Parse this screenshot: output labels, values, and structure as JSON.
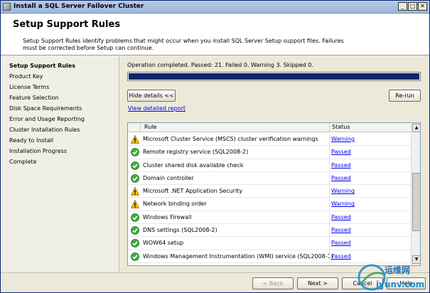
{
  "window": {
    "title": "Install a SQL Server Failover Cluster"
  },
  "header": {
    "title": "Setup Support Rules",
    "description": "Setup Support Rules identify problems that might occur when you install SQL Server Setup support files. Failures must be corrected before Setup can continue."
  },
  "sidebar": {
    "items": [
      {
        "label": "Setup Support Rules",
        "active": true
      },
      {
        "label": "Product Key"
      },
      {
        "label": "License Terms"
      },
      {
        "label": "Feature Selection"
      },
      {
        "label": "Disk Space Requirements"
      },
      {
        "label": "Error and Usage Reporting"
      },
      {
        "label": "Cluster Installation Rules"
      },
      {
        "label": "Ready to Install"
      },
      {
        "label": "Installation Progress"
      },
      {
        "label": "Complete"
      }
    ]
  },
  "main": {
    "status_text": "Operation completed. Passed: 21.   Failed 0.   Warning 3.   Skipped 0.",
    "progress_fraction": 1.0,
    "hide_details_label": "Hide details <<",
    "rerun_label": "Re-run",
    "view_report_label": "View detailed report",
    "columns": {
      "rule": "Rule",
      "status": "Status"
    },
    "rows": [
      {
        "icon": "warning-icon",
        "rule": "Microsoft Cluster Service (MSCS) cluster verification warnings",
        "status": "Warning"
      },
      {
        "icon": "check-icon",
        "rule": "Remote registry service (SQL2008-2)",
        "status": "Passed"
      },
      {
        "icon": "check-icon",
        "rule": "Cluster shared disk available check",
        "status": "Passed"
      },
      {
        "icon": "check-icon",
        "rule": "Domain controller",
        "status": "Passed"
      },
      {
        "icon": "warning-icon",
        "rule": "Microsoft .NET Application Security",
        "status": "Warning"
      },
      {
        "icon": "warning-icon",
        "rule": "Network binding order",
        "status": "Warning"
      },
      {
        "icon": "check-icon",
        "rule": "Windows Firewall",
        "status": "Passed"
      },
      {
        "icon": "check-icon",
        "rule": "DNS settings (SQL2008-2)",
        "status": "Passed"
      },
      {
        "icon": "check-icon",
        "rule": "WOW64 setup",
        "status": "Passed"
      },
      {
        "icon": "check-icon",
        "rule": "Windows Management Instrumentation (WMI) service (SQL2008-1)",
        "status": "Passed"
      }
    ]
  },
  "footer": {
    "back_label": "< Back",
    "next_label": "Next >",
    "cancel_label": "Cancel",
    "help_label": "Help"
  },
  "watermark": {
    "text_cn": "运维网",
    "text_en": "iyunv.com"
  }
}
